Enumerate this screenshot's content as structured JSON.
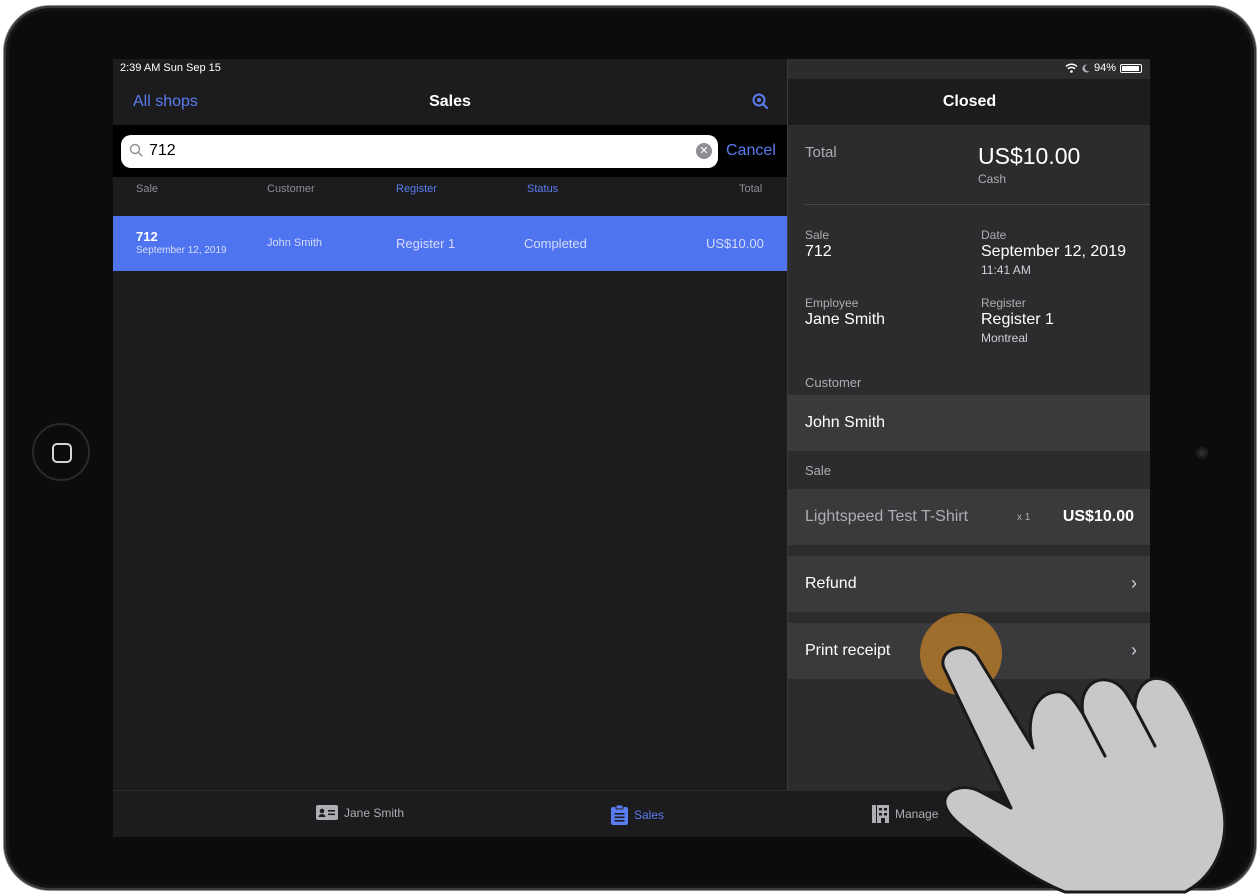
{
  "status_bar": {
    "time": "2:39 AM  Sun Sep 15",
    "battery": "94%"
  },
  "left_nav": {
    "back_label": "All shops",
    "title": "Sales"
  },
  "search": {
    "value": "712",
    "cancel_label": "Cancel"
  },
  "columns": [
    "Sale",
    "Customer",
    "Register",
    "Status",
    "Total"
  ],
  "rows": [
    {
      "sale": "712",
      "date": "September 12, 2019",
      "customer": "John Smith",
      "register": "Register 1",
      "status": "Completed",
      "total": "US$10.00"
    }
  ],
  "detail": {
    "title": "Closed",
    "total_label": "Total",
    "total_value": "US$10.00",
    "payment_method": "Cash",
    "sale_label": "Sale",
    "sale_value": "712",
    "date_label": "Date",
    "date_value": "September 12, 2019",
    "time_value": "11:41 AM",
    "employee_label": "Employee",
    "employee_value": "Jane Smith",
    "register_label": "Register",
    "register_value": "Register 1",
    "register_location": "Montreal",
    "customer_section": "Customer",
    "customer_value": "John Smith",
    "sale_section": "Sale",
    "item_name": "Lightspeed Test T-Shirt",
    "item_qty": "x 1",
    "item_price": "US$10.00",
    "refund_label": "Refund",
    "print_label": "Print receipt"
  },
  "tabbar": {
    "employee": "Jane Smith",
    "sales": "Sales",
    "manage": "Manage"
  },
  "colors": {
    "accent": "#5a7cf0",
    "selected_row": "#4f74f0",
    "touch": "#be7d28"
  }
}
